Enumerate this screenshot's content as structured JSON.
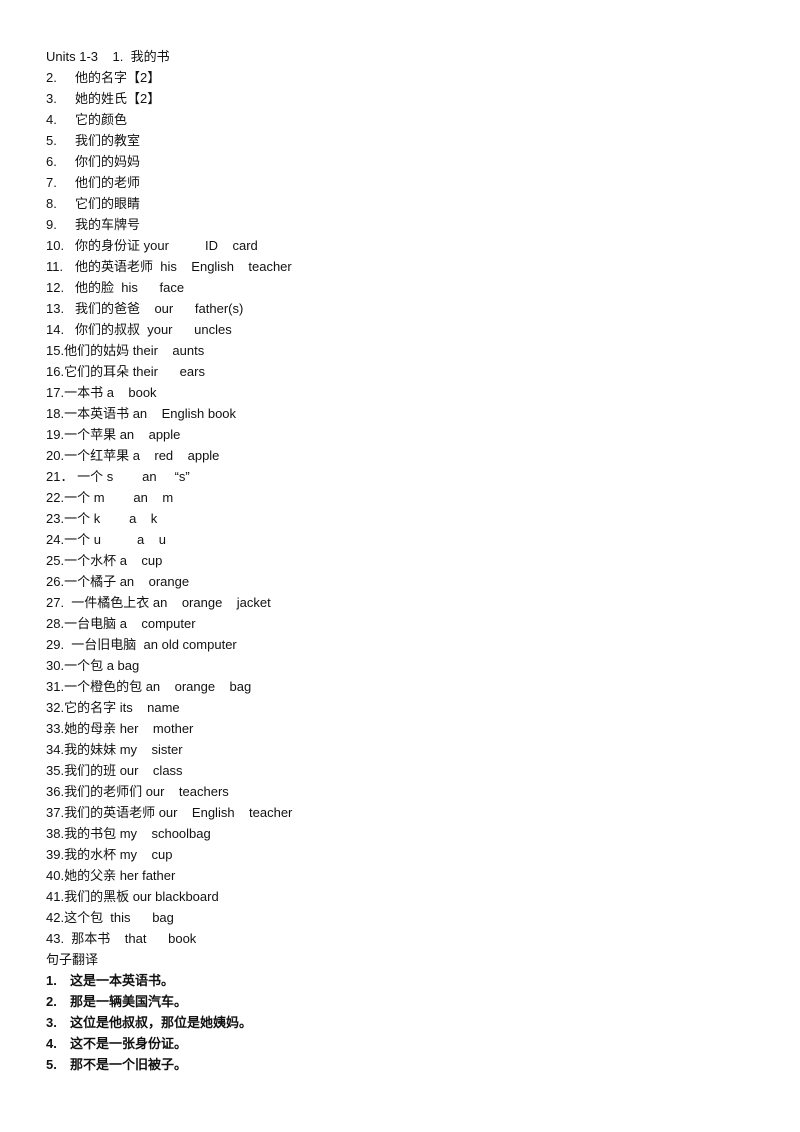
{
  "header": {
    "unit": "Units 1-3",
    "first_num": "1.",
    "first_text": "我的书"
  },
  "vocab": [
    {
      "num": "2.",
      "text": "他的名字【2】"
    },
    {
      "num": "3.",
      "text": "她的姓氏【2】"
    },
    {
      "num": "4.",
      "text": "它的颜色"
    },
    {
      "num": "5.",
      "text": "我们的教室"
    },
    {
      "num": "6.",
      "text": "你们的妈妈"
    },
    {
      "num": "7.",
      "text": "他们的老师"
    },
    {
      "num": "8.",
      "text": "它们的眼睛"
    },
    {
      "num": "9.",
      "text": "我的车牌号"
    },
    {
      "num": "10.",
      "text": "你的身份证 your          ID    card"
    },
    {
      "num": "11.",
      "text": "他的英语老师  his    English    teacher"
    },
    {
      "num": "12.",
      "text": "他的脸  his      face"
    },
    {
      "num": "13.",
      "text": "我们的爸爸    our      father(s)"
    },
    {
      "num": "14.",
      "text": "你们的叔叔  your      uncles"
    },
    {
      "num": "15.",
      "text": "他们的姑妈 their    aunts"
    },
    {
      "num": "16.",
      "text": "它们的耳朵 their      ears"
    },
    {
      "num": "17.",
      "text": "一本书 a    book"
    },
    {
      "num": "18.",
      "text": "一本英语书 an    English book"
    },
    {
      "num": "19.",
      "text": "一个苹果 an    apple"
    },
    {
      "num": "20.",
      "text": "一个红苹果 a    red    apple"
    },
    {
      "num": "21．",
      "text": " 一个 s        an     “s”"
    },
    {
      "num": "22.",
      "text": "一个 m        an    m"
    },
    {
      "num": "23.",
      "text": "一个 k        a    k"
    },
    {
      "num": "24.",
      "text": "一个 u          a    u"
    },
    {
      "num": "25.",
      "text": "一个水杯 a    cup"
    },
    {
      "num": "26.",
      "text": "一个橘子 an    orange"
    },
    {
      "num": "27.",
      "text": "  一件橘色上衣 an    orange    jacket"
    },
    {
      "num": "28.",
      "text": "一台电脑 a    computer"
    },
    {
      "num": "29.",
      "text": "  一台旧电脑  an old computer"
    },
    {
      "num": "30.",
      "text": "一个包 a bag"
    },
    {
      "num": "31.",
      "text": "一个橙色的包 an    orange    bag"
    },
    {
      "num": "32.",
      "text": "它的名字 its    name"
    },
    {
      "num": "33.",
      "text": "她的母亲 her    mother"
    },
    {
      "num": "34.",
      "text": "我的妹妹 my    sister"
    },
    {
      "num": "35.",
      "text": "我们的班 our    class"
    },
    {
      "num": "36.",
      "text": "我们的老师们 our    teachers"
    },
    {
      "num": "37.",
      "text": "我们的英语老师 our    English    teacher"
    },
    {
      "num": "38.",
      "text": "我的书包 my    schoolbag"
    },
    {
      "num": "39.",
      "text": "我的水杯 my    cup"
    },
    {
      "num": "40.",
      "text": "她的父亲 her father"
    },
    {
      "num": "41.",
      "text": "我们的黑板 our blackboard"
    },
    {
      "num": "42.",
      "text": "这个包  this      bag"
    },
    {
      "num": "43.",
      "text": "  那本书    that      book"
    }
  ],
  "section_title": "句子翻译",
  "sentences": [
    {
      "num": "1.",
      "text": "这是一本英语书。"
    },
    {
      "num": "2.",
      "text": "那是一辆美国汽车。"
    },
    {
      "num": "3.",
      "text": "这位是他叔叔，那位是她姨妈。"
    },
    {
      "num": "4.",
      "text": "这不是一张身份证。"
    },
    {
      "num": "5.",
      "text": "那不是一个旧被子。"
    }
  ]
}
